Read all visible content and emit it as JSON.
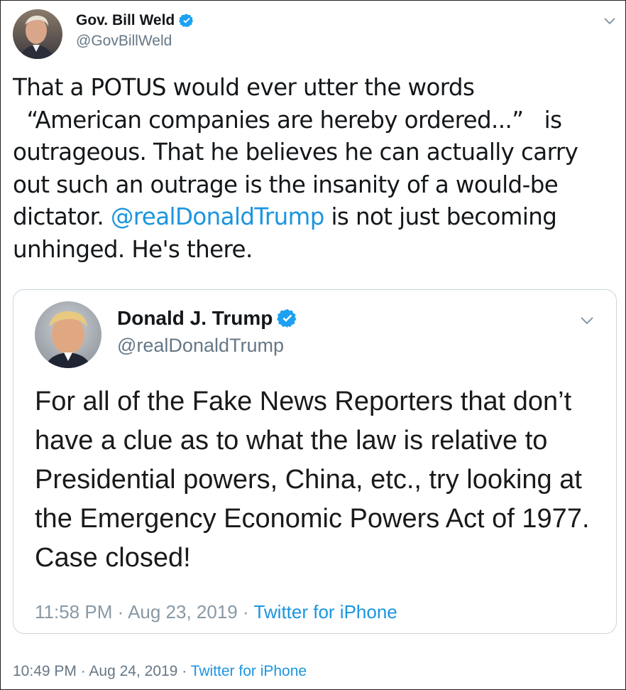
{
  "tweet": {
    "author": {
      "display_name": "Gov. Bill Weld",
      "handle": "@GovBillWeld",
      "verified": true
    },
    "text_parts": {
      "p1": "That a POTUS would ever utter the words\n  “American companies are hereby ordered...”   is outrageous. That he believes he can actually carry out such an outrage is the insanity of a would-be dictator. ",
      "mention": "@realDonaldTrump",
      "p2": " is not just becoming unhinged. He's there."
    },
    "time": "10:49 PM",
    "date": "Aug 24, 2019",
    "separator": "·",
    "source": "Twitter for iPhone",
    "menu_icon": "chevron-down-icon"
  },
  "quoted_tweet": {
    "author": {
      "display_name": "Donald J. Trump",
      "handle": "@realDonaldTrump",
      "verified": true
    },
    "text": "For all of the Fake News Reporters that don’t have a clue as to what the law is relative to Presidential powers, China, etc., try looking at the Emergency Economic Powers Act of 1977. Case closed!",
    "time": "11:58 PM",
    "date": "Aug 23, 2019",
    "separator": "·",
    "source": "Twitter for iPhone",
    "menu_icon": "chevron-down-icon"
  },
  "colors": {
    "link": "#1b95e0",
    "verified": "#1da1f2",
    "secondary_text": "#657786",
    "card_border": "#ccd6dd"
  }
}
